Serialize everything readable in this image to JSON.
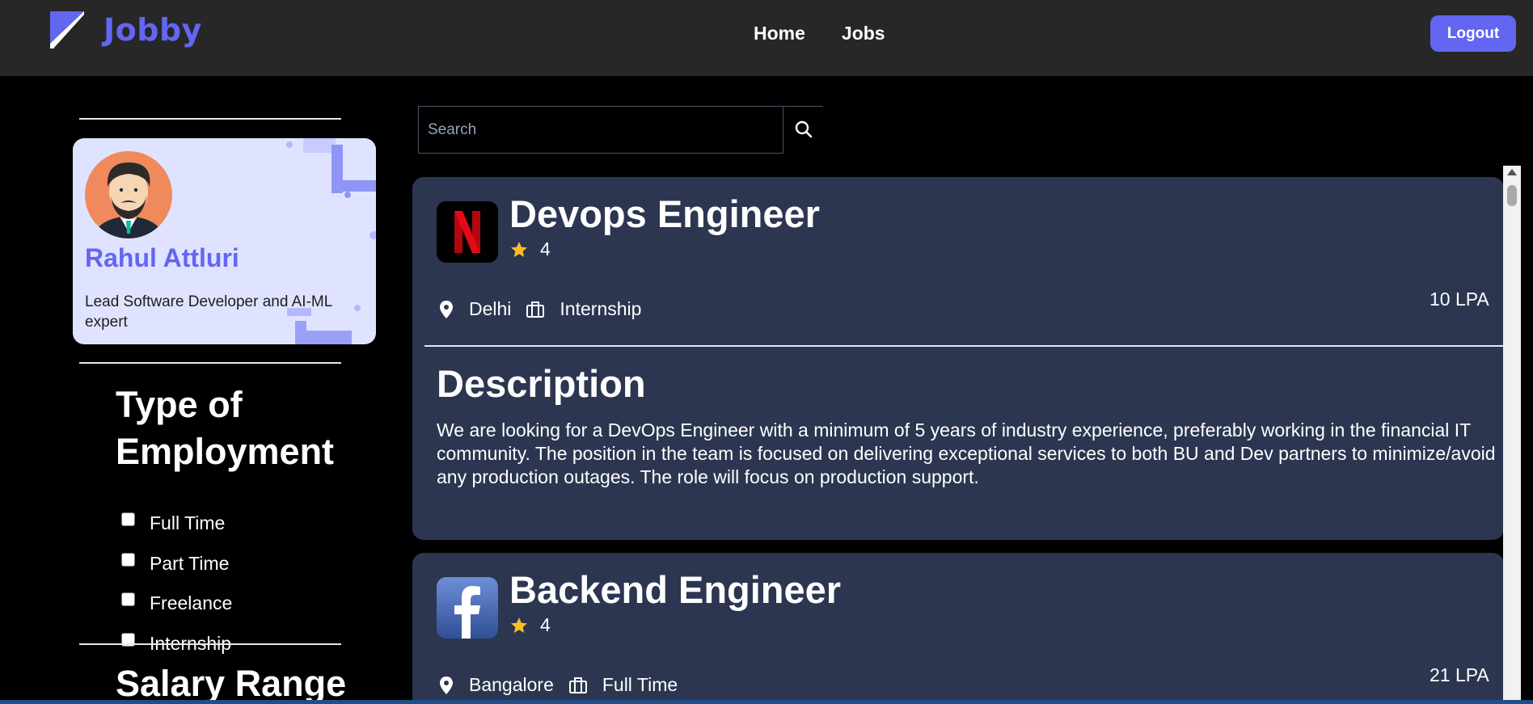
{
  "navbar": {
    "brand": "Jobby",
    "links": [
      {
        "label": "Home"
      },
      {
        "label": "Jobs"
      }
    ],
    "logout_label": "Logout",
    "accent_color": "#6366f1"
  },
  "profile": {
    "name": "Rahul Attluri",
    "bio": "Lead Software Developer and AI-ML expert"
  },
  "filters": {
    "employment_title": "Type of Employment",
    "employment_options": [
      {
        "label": "Full Time"
      },
      {
        "label": "Part Time"
      },
      {
        "label": "Freelance"
      },
      {
        "label": "Internship"
      }
    ],
    "salary_title": "Salary Range"
  },
  "search": {
    "placeholder": "Search",
    "icon": "search-icon"
  },
  "jobs": [
    {
      "company_icon": "netflix-logo",
      "title": "Devops Engineer",
      "rating": "4",
      "location": "Delhi",
      "employment_type": "Internship",
      "package": "10 LPA",
      "description_heading": "Description",
      "description": "We are looking for a DevOps Engineer with a minimum of 5 years of industry experience, preferably working in the financial IT community. The position in the team is focused on delivering exceptional services to both BU and Dev partners to minimize/avoid any production outages. The role will focus on production support."
    },
    {
      "company_icon": "facebook-logo",
      "title": "Backend Engineer",
      "rating": "4",
      "location": "Bangalore",
      "employment_type": "Full Time",
      "package": "21 LPA"
    }
  ]
}
